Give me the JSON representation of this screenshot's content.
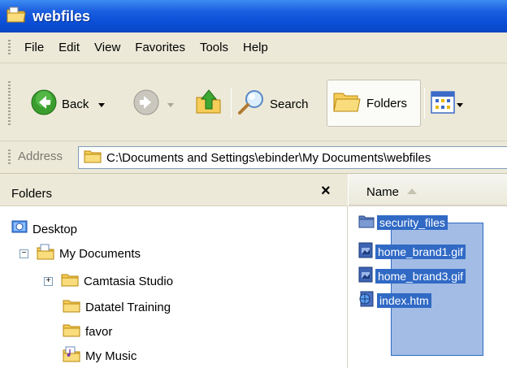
{
  "window": {
    "title": "webfiles"
  },
  "menu": {
    "items": [
      "File",
      "Edit",
      "View",
      "Favorites",
      "Tools",
      "Help"
    ]
  },
  "toolbar": {
    "back_label": "Back",
    "search_label": "Search",
    "folders_label": "Folders"
  },
  "address": {
    "label": "Address",
    "value": "C:\\Documents and Settings\\ebinder\\My Documents\\webfiles"
  },
  "folders_pane": {
    "title": "Folders",
    "close_glyph": "×",
    "tree": [
      {
        "label": "Desktop",
        "icon": "desktop-icon",
        "expander": ""
      },
      {
        "label": "My Documents",
        "icon": "my-documents-icon",
        "expander": "−"
      },
      {
        "label": "Camtasia Studio",
        "icon": "folder-icon",
        "expander": "+"
      },
      {
        "label": "Datatel Training",
        "icon": "folder-icon",
        "expander": ""
      },
      {
        "label": "favor",
        "icon": "folder-icon",
        "expander": ""
      },
      {
        "label": "My Music",
        "icon": "music-folder-icon",
        "expander": ""
      }
    ]
  },
  "files_pane": {
    "column_name": "Name",
    "files": [
      {
        "name": "security_files",
        "icon": "folder-icon"
      },
      {
        "name": "home_brand1.gif",
        "icon": "image-file-icon"
      },
      {
        "name": "home_brand3.gif",
        "icon": "image-file-icon"
      },
      {
        "name": "index.htm",
        "icon": "html-file-icon"
      }
    ]
  },
  "colors": {
    "title_bar": "#0a4fd6",
    "chrome": "#ece9d8",
    "selection": "#316ac5"
  }
}
